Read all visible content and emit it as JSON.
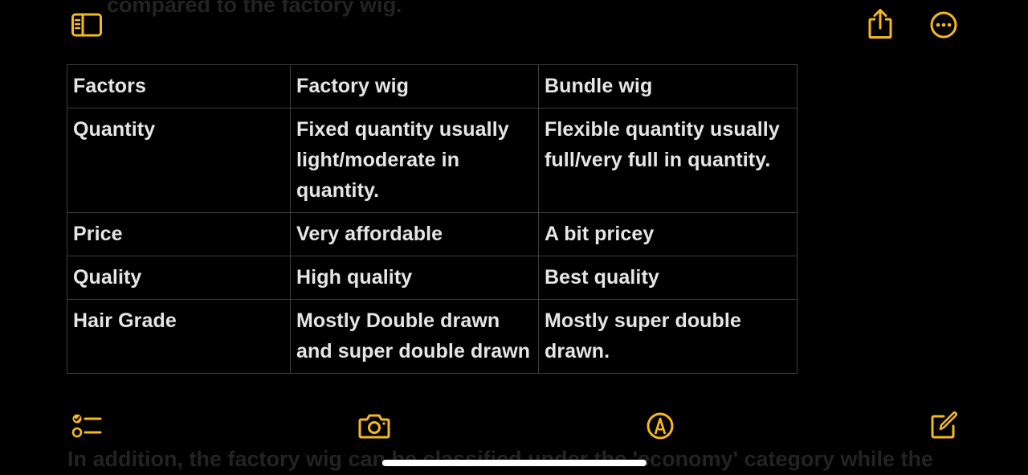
{
  "background_note": {
    "top_line": "compared to the factory wig.",
    "bottom_line": "In addition, the factory wig can be classified under the 'economy' category while the"
  },
  "top_toolbar": {
    "left_icon": "sidebar-icon",
    "right_icons": [
      "share-icon",
      "more-icon"
    ]
  },
  "table": {
    "rows": [
      [
        "Factors",
        "Factory wig",
        "Bundle wig"
      ],
      [
        "Quantity",
        "Fixed quantity usually light/moderate in quantity.",
        "Flexible quantity usually full/very full in quantity."
      ],
      [
        "Price",
        "Very affordable",
        "A bit pricey"
      ],
      [
        "Quality",
        "High quality",
        "Best quality"
      ],
      [
        "Hair Grade",
        "Mostly Double drawn and super double drawn",
        "Mostly super double drawn."
      ]
    ]
  },
  "bottom_toolbar": {
    "icons": [
      "checklist-icon",
      "camera-icon",
      "markup-icon",
      "compose-icon"
    ]
  },
  "colors": {
    "accent": "#f5b820",
    "background": "#000000",
    "text": "#e6e6e6",
    "grid": "#3e3e3e"
  }
}
